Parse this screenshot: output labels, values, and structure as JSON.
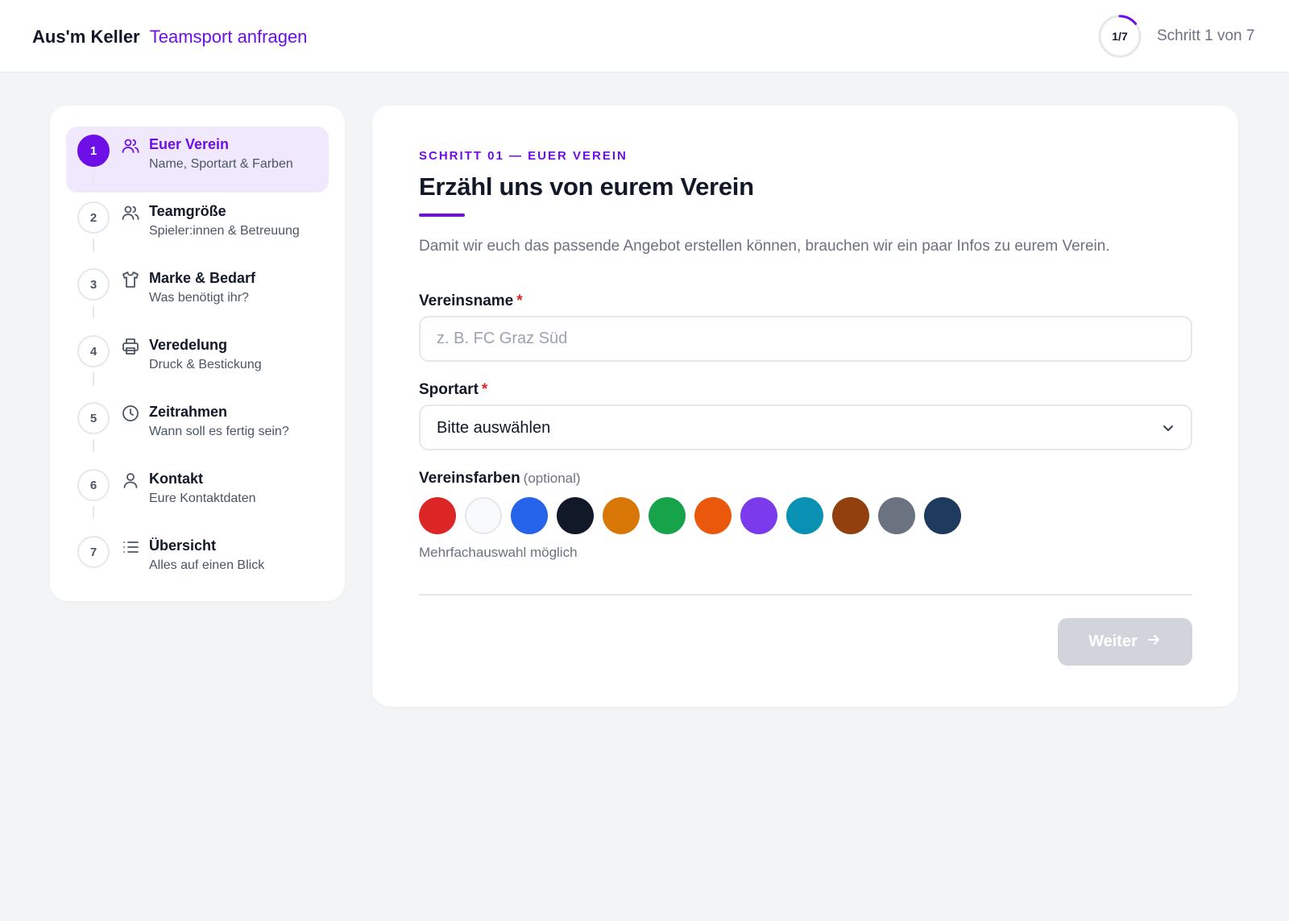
{
  "header": {
    "brand_name": "Aus'm Keller",
    "brand_subtitle": "Teamsport anfragen",
    "progress": {
      "label": "1/7",
      "current": 1,
      "total": 7,
      "fraction": 0.1429
    },
    "step_counter": "Schritt 1 von 7"
  },
  "sidebar": {
    "steps": [
      {
        "number": "1",
        "icon": "users-icon",
        "title": "Euer Verein",
        "description": "Name, Sportart & Farben",
        "active": true
      },
      {
        "number": "2",
        "icon": "users-icon",
        "title": "Teamgröße",
        "description": "Spieler:innen & Betreuung",
        "active": false
      },
      {
        "number": "3",
        "icon": "shirt-icon",
        "title": "Marke & Bedarf",
        "description": "Was benötigt ihr?",
        "active": false
      },
      {
        "number": "4",
        "icon": "printer-icon",
        "title": "Veredelung",
        "description": "Druck & Bestickung",
        "active": false
      },
      {
        "number": "5",
        "icon": "clock-icon",
        "title": "Zeitrahmen",
        "description": "Wann soll es fertig sein?",
        "active": false
      },
      {
        "number": "6",
        "icon": "user-icon",
        "title": "Kontakt",
        "description": "Eure Kontaktdaten",
        "active": false
      },
      {
        "number": "7",
        "icon": "list-icon",
        "title": "Übersicht",
        "description": "Alles auf einen Blick",
        "active": false
      }
    ]
  },
  "main": {
    "eyebrow": "SCHRITT 01 — EUER VEREIN",
    "title": "Erzähl uns von eurem Verein",
    "intro": "Damit wir euch das passende Angebot erstellen können, brauchen wir ein paar Infos zu eurem Verein.",
    "club_name": {
      "label": "Vereinsname",
      "required_mark": "*",
      "placeholder": "z. B. FC Graz Süd",
      "value": ""
    },
    "sport": {
      "label": "Sportart",
      "required_mark": "*",
      "selected": "Bitte auswählen"
    },
    "colors": {
      "label": "Vereinsfarben",
      "optional": "(optional)",
      "swatches": [
        "#dc2626",
        "#f9fafb",
        "#2563eb",
        "#111827",
        "#d97706",
        "#16a34a",
        "#ea580c",
        "#7c3aed",
        "#0891b2",
        "#92400e",
        "#6b7280",
        "#1e3a5f"
      ],
      "hint": "Mehrfachauswahl möglich"
    },
    "next_button": {
      "label": "Weiter",
      "disabled": true
    }
  },
  "theme": {
    "accent": "#6d0fe6",
    "active_step_bg": "#f0e9fe",
    "page_bg": "#f3f4f6",
    "required": "#dc2626",
    "disabled_button": "#d1d5db"
  }
}
